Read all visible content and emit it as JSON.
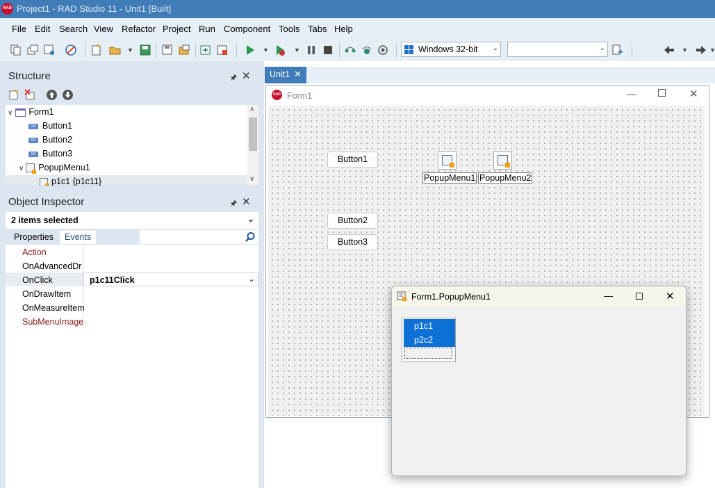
{
  "titlebar": {
    "logo": "RAD",
    "title": "Project1 - RAD Studio 11 - Unit1 [Built]"
  },
  "menu": [
    "File",
    "Edit",
    "Search",
    "View",
    "Refactor",
    "Project",
    "Run",
    "Component",
    "Tools",
    "Tabs",
    "Help"
  ],
  "toolbar": {
    "platform": "Windows 32-bit",
    "config": ""
  },
  "structure": {
    "title": "Structure",
    "tree": [
      "Form1",
      "Button1",
      "Button2",
      "Button3",
      "PopupMenu1",
      "p1c1 {p1c11}"
    ]
  },
  "inspector": {
    "title": "Object Inspector",
    "selection": "2 items selected",
    "tabs": [
      "Properties",
      "Events"
    ],
    "events": [
      {
        "name": "Action",
        "value": ""
      },
      {
        "name": "OnAdvancedDra",
        "value": ""
      },
      {
        "name": "OnClick",
        "value": "p1c11Click"
      },
      {
        "name": "OnDrawItem",
        "value": ""
      },
      {
        "name": "OnMeasureItem",
        "value": ""
      },
      {
        "name": "SubMenuImages",
        "value": ""
      }
    ]
  },
  "editor": {
    "tab": "Unit1"
  },
  "form": {
    "caption": "Form1",
    "buttons": [
      "Button1",
      "Button2",
      "Button3"
    ],
    "components": [
      "PopupMenu1",
      "PopupMenu2"
    ]
  },
  "popup_editor": {
    "title": "Form1.PopupMenu1",
    "items": [
      "p1c1",
      "p2c2"
    ]
  },
  "icons": [
    "rad-logo-icon",
    "pin-icon",
    "close-icon",
    "chevron-down-icon",
    "search-icon",
    "run-icon",
    "pause-icon",
    "stop-icon",
    "back-arrow-icon",
    "forward-arrow-icon",
    "minimize-icon",
    "maximize-icon"
  ]
}
